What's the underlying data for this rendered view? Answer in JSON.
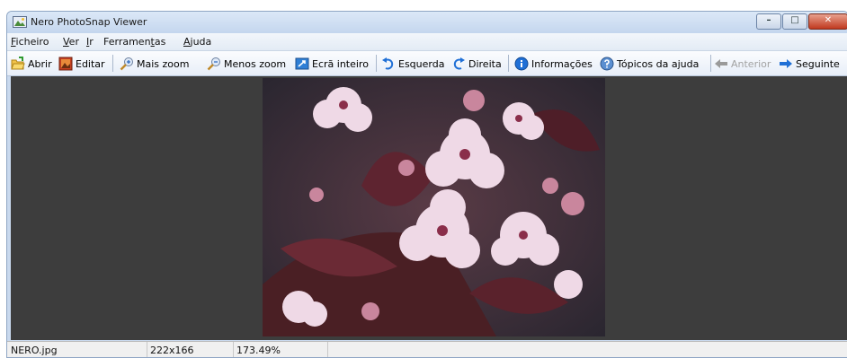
{
  "window": {
    "title": "Nero PhotoSnap Viewer"
  },
  "menu": {
    "ficheiro": {
      "u": "F",
      "rest": "icheiro"
    },
    "ver": {
      "u": "V",
      "rest": "er"
    },
    "ir": {
      "u": "I",
      "rest": "r"
    },
    "ferramentas": {
      "pre": "Ferramen",
      "u": "t",
      "rest": "as"
    },
    "ajuda": {
      "u": "A",
      "rest": "juda"
    }
  },
  "toolbar": {
    "abrir": "Abrir",
    "editar": "Editar",
    "mais_zoom": "Mais zoom",
    "menos_zoom": "Menos zoom",
    "ecra_inteiro": "Ecrã inteiro",
    "esquerda": "Esquerda",
    "direita": "Direita",
    "informacoes": "Informações",
    "topicos": "Tópicos da ajuda",
    "anterior": "Anterior",
    "seguinte": "Seguinte"
  },
  "status": {
    "filename": "NERO.jpg",
    "dimensions": "222x166",
    "zoom": "173.49%"
  },
  "icons": {
    "app": "photo-viewer-icon",
    "abrir": "folder-open-icon",
    "editar": "edit-image-icon",
    "mais_zoom": "zoom-in-icon",
    "menos_zoom": "zoom-out-icon",
    "ecra_inteiro": "fullscreen-icon",
    "esquerda": "rotate-left-icon",
    "direita": "rotate-right-icon",
    "informacoes": "info-icon",
    "topicos": "help-icon",
    "anterior": "arrow-left-icon",
    "seguinte": "arrow-right-icon"
  },
  "colors": {
    "viewer_background": "#3d3d3d",
    "accent_blue": "#1f6fd6"
  }
}
